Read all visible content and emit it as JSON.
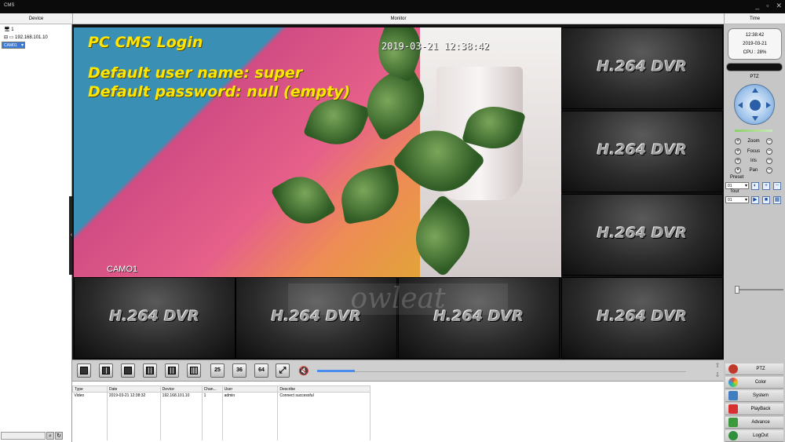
{
  "window": {
    "title": "CMS",
    "controls": [
      "_",
      "▫",
      "✕"
    ]
  },
  "headers": {
    "device": "Device",
    "monitor": "Monitor",
    "time": "Time"
  },
  "device_tree": {
    "root": "1",
    "device": "192.168.101.10",
    "channel": "CAM01"
  },
  "camera": {
    "overlay_title": "PC CMS Login",
    "overlay_user": "Default user name: super",
    "overlay_password": "Default password: null (empty)",
    "timestamp": "2019-03-21  12:38:42",
    "label": "CAMO1",
    "watermark": "owleat"
  },
  "tiles": [
    "H.264 DVR",
    "H.264 DVR",
    "H.264 DVR",
    "H.264 DVR",
    "H.264 DVR",
    "H.264 DVR",
    "H.264 DVR"
  ],
  "layout_buttons": [
    "1",
    "4",
    "6",
    "9",
    "12",
    "16",
    "25",
    "36",
    "64"
  ],
  "log": {
    "columns": [
      "Type",
      "Date",
      "Device",
      "Chan...",
      "User",
      "Describe"
    ],
    "rows": [
      {
        "type": "Video",
        "date": "2019-03-21 12:38:32",
        "device": "192.168.101.10",
        "channel": "1",
        "user": "admin",
        "describe": "Connect successful"
      }
    ]
  },
  "clock": {
    "time": "12:38:42",
    "date": "2019-03-21",
    "cpu": "CPU : 28%"
  },
  "ptz": {
    "label": "PTZ",
    "controls": [
      "Zoom",
      "Focus",
      "Iris",
      "Pan"
    ],
    "preset_label": "Preset",
    "preset_value": "01",
    "tour_label": "Tour",
    "tour_value": "01"
  },
  "menu": [
    {
      "label": "PTZ",
      "color": "#c0392b"
    },
    {
      "label": "Color",
      "color": "#2e86de"
    },
    {
      "label": "System",
      "color": "#3f7fbf"
    },
    {
      "label": "PlayBack",
      "color": "#d63031"
    },
    {
      "label": "Advance",
      "color": "#3c9a3c"
    },
    {
      "label": "LogOut",
      "color": "#2f8f3a"
    }
  ],
  "colors": {
    "selection": "#3b7bd6",
    "overlay_text": "#ffe600",
    "volume": "#4a8cf0"
  }
}
